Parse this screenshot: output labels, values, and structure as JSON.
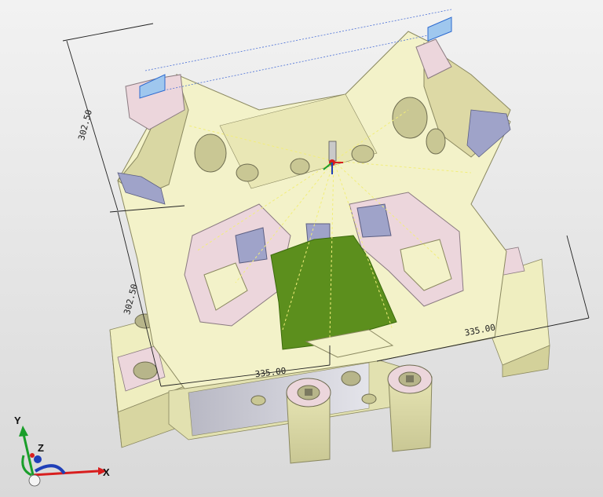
{
  "dimensions": {
    "height_upper": "302.50",
    "height_lower": "302.50",
    "width_front": "335.00",
    "width_side": "335.00"
  },
  "triad": {
    "x_label": "X",
    "y_label": "Y",
    "z_label": "Z",
    "x_color": "#d81e1e",
    "y_color": "#1a9e2a",
    "z_color": "#1f3fb8"
  },
  "colors": {
    "part_face": "#efeec0",
    "part_side": "#dcdaa4",
    "part_shadow": "#b9b78a",
    "pink_face": "#ecd6dc",
    "machined_blue": "#9fa3c9",
    "green_floor": "#5c8f1d",
    "toolpath": "#f4f18a",
    "dim_line": "#222222",
    "stock_outline": "#4a6fd6"
  }
}
